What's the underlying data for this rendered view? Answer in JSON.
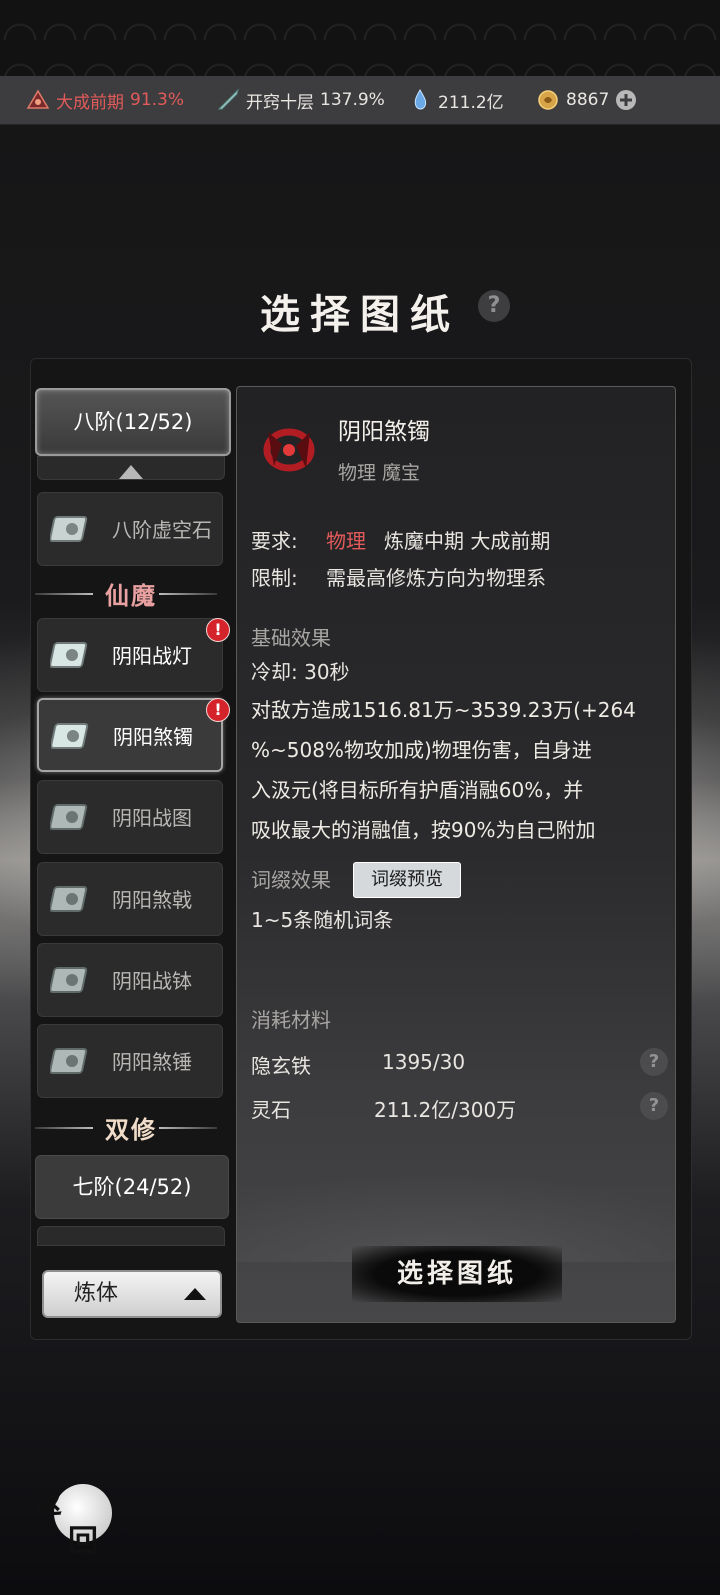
{
  "status_bar": {
    "realm": {
      "label": "大成前期",
      "value": "91.3%"
    },
    "meridian": {
      "label": "开窍十层",
      "value": "137.9%"
    },
    "spirit_stone": {
      "value": "211.2亿"
    },
    "gold": {
      "value": "8867"
    }
  },
  "page": {
    "title": "选择图纸"
  },
  "sidebar": {
    "tier_top": "八阶(12/52)",
    "items_top": [
      {
        "label": "八阶虚空石"
      }
    ],
    "section1": "仙魔",
    "items": [
      {
        "label": "阴阳战灯",
        "badge": "!"
      },
      {
        "label": "阴阳煞镯",
        "badge": "!"
      },
      {
        "label": "阴阳战图"
      },
      {
        "label": "阴阳煞戟"
      },
      {
        "label": "阴阳战钵"
      },
      {
        "label": "阴阳煞锤"
      }
    ],
    "section2": "双修",
    "tier_bottom": "七阶(24/52)",
    "selector": "炼体"
  },
  "detail": {
    "name": "阴阳煞镯",
    "tags": "物理  魔宝",
    "require_label": "要求:",
    "require_type": "物理",
    "require_rest": "炼魔中期  大成前期",
    "limit_label": "限制:",
    "limit_value": "需最高修炼方向为物理系",
    "base_effect_label": "基础效果",
    "cooldown": "冷却: 30秒",
    "desc_lines": [
      "对敌方造成1516.81万~3539.23万(+264",
      "%~508%物攻加成)物理伤害，自身进",
      "入汲元(将目标所有护盾消融60%，并",
      "吸收最大的消融值，按90%为自己附加"
    ],
    "affix_label": "词缀效果",
    "affix_preview": "词缀预览",
    "affix_value": "1~5条随机词条",
    "materials_label": "消耗材料",
    "materials": [
      {
        "name": "隐玄铁",
        "amount": "1395/30"
      },
      {
        "name": "灵石",
        "amount": "211.2亿/300万"
      }
    ],
    "action": "选择图纸"
  },
  "back": {
    "c1": "返",
    "c2": "回"
  },
  "colors": {
    "accent_red": "#e25a5a",
    "badge_red": "#d4232a",
    "section_red": "#e8a0a0"
  }
}
